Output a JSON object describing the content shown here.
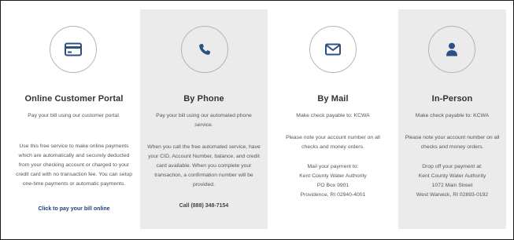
{
  "columns": {
    "portal": {
      "title": "Online Customer Portal",
      "intro": "Pay your bill using our customer portal.",
      "details": "Use this free service to make online payments which are automatically and securely deducted from your checking account or charged to your credit card with no transaction fee. You can setup one-time payments or automatic payments.",
      "link_label": "Click to pay your bill online",
      "icon": "credit-card-icon"
    },
    "phone": {
      "title": "By Phone",
      "intro": "Pay your bill using our automated phone service.",
      "details": "When you call the free automated service, have your CID, Account Number, balance, and credit card available. When you complete your transaction, a confirmation number will be provided.",
      "phone_label": "Call (888) 348-7154",
      "icon": "phone-icon"
    },
    "mail": {
      "title": "By Mail",
      "payable": "Make check payable to: KCWA",
      "note": "Please note your account number on all checks and money orders.",
      "address_label": "Mail your payment to:",
      "address_line1": "Kent County Water Authority",
      "address_line2": "PO Box 9901",
      "address_line3": "Providence, RI 02940-4001",
      "icon": "envelope-icon"
    },
    "in_person": {
      "title": "In-Person",
      "payable": "Make check payable to: KCWA",
      "note": "Please note your account number on all checks and money orders.",
      "address_label": "Drop off your payment at:",
      "address_line1": "Kent County Water Authority",
      "address_line2": "1072 Main Street",
      "address_line3": "West Warwick, RI 02893-0192",
      "icon": "person-icon"
    }
  },
  "colors": {
    "icon_blue": "#2c4f86",
    "link_blue": "#1f3f7a",
    "shaded_column": "#ebebeb"
  }
}
